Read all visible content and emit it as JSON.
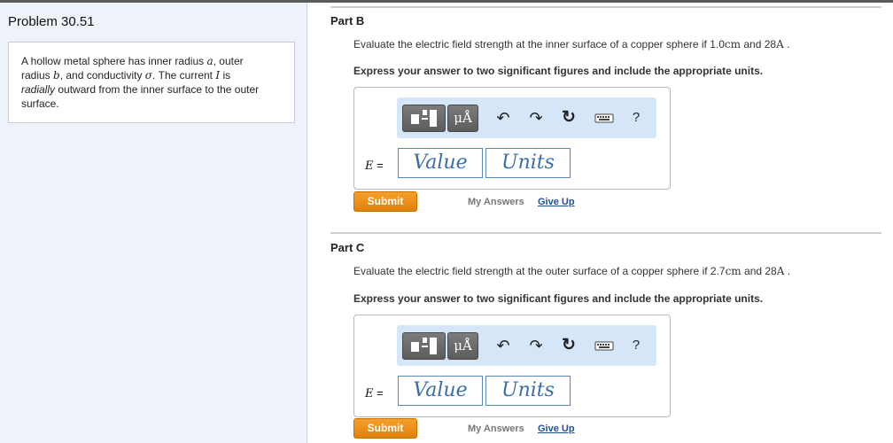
{
  "problem": {
    "title": "Problem 30.51",
    "statement_line1_a": "A hollow metal sphere has inner radius ",
    "var_a": "a",
    "statement_line1_b": ", outer",
    "statement_line2_a": "radius ",
    "var_b": "b",
    "statement_line2_b": ", and conductivity ",
    "var_sigma": "σ",
    "statement_line2_c": ". The current ",
    "var_I": "I",
    "statement_line2_d": " is",
    "statement_line3_italic": "radially",
    "statement_line3_b": " outward from the inner surface to the outer",
    "statement_line4": "surface."
  },
  "parts": [
    {
      "title": "Part B",
      "question_prefix": "Evaluate the electric field strength at the inner surface of a copper sphere if 1.0",
      "unit1": "cm",
      "question_mid": " and 28",
      "unit2": "A",
      "question_end": " .",
      "instruction": "Express your answer to two significant figures and include the appropriate units.",
      "toolbar": {
        "units_label": "μÅ",
        "undo_glyph": "↶",
        "redo_glyph": "↷",
        "reset_glyph": "↻",
        "help_label": "?"
      },
      "equation_label": "E",
      "equals": " =",
      "value_placeholder": "Value",
      "units_placeholder": "Units",
      "submit_label": "Submit",
      "my_answers_label": "My Answers",
      "give_up_label": "Give Up"
    },
    {
      "title": "Part C",
      "question_prefix": "Evaluate the electric field strength at the outer surface of a copper sphere if 2.7",
      "unit1": "cm",
      "question_mid": " and 28",
      "unit2": "A",
      "question_end": " .",
      "instruction": "Express your answer to two significant figures and include the appropriate units.",
      "toolbar": {
        "units_label": "μÅ",
        "undo_glyph": "↶",
        "redo_glyph": "↷",
        "reset_glyph": "↻",
        "help_label": "?"
      },
      "equation_label": "E",
      "equals": " =",
      "value_placeholder": "Value",
      "units_placeholder": "Units",
      "submit_label": "Submit",
      "my_answers_label": "My Answers",
      "give_up_label": "Give Up"
    }
  ],
  "colors": {
    "submit_orange": "#e8890f",
    "toolbar_blue": "#d4e6f8",
    "link_blue": "#1f4f9c",
    "field_border": "#5a87b3"
  }
}
